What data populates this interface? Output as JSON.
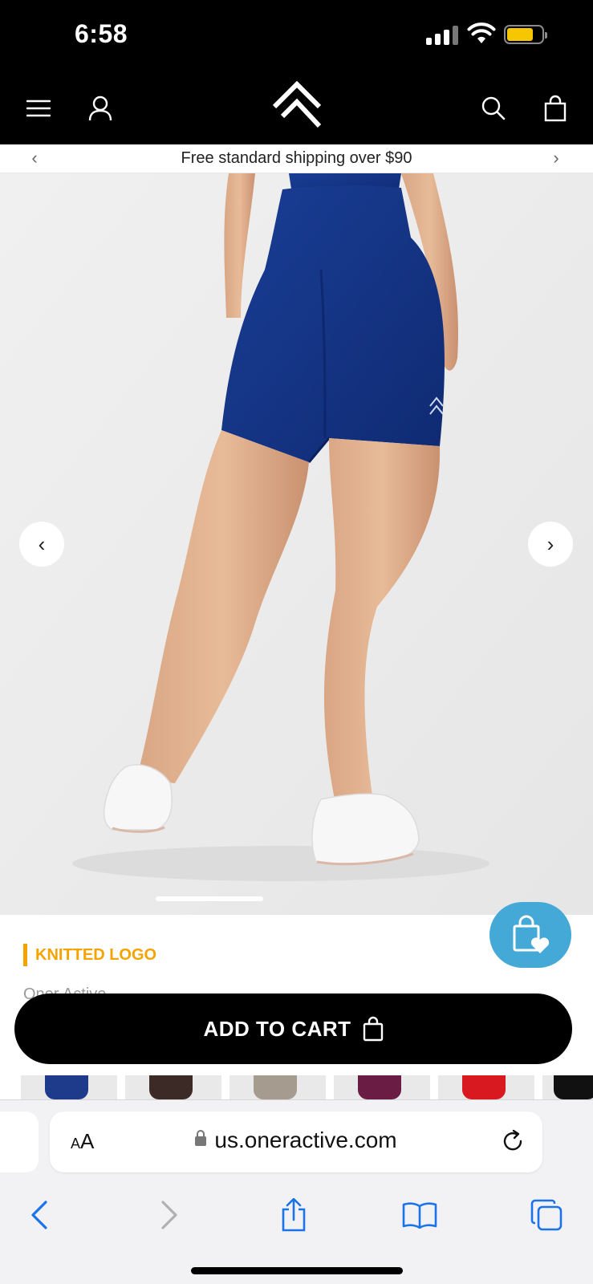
{
  "status_bar": {
    "time": "6:58"
  },
  "announcement": {
    "text": "Free standard shipping over $90"
  },
  "carousel": {
    "position": 0.32
  },
  "product": {
    "tagline": "KNITTED LOGO",
    "brand": "Oner Active",
    "add_to_cart_label": "ADD TO CART"
  },
  "swatch_colors": [
    "#1e3a8a",
    "#3b2a25",
    "#a59b8e",
    "#6b1c44",
    "#d81920",
    "#111111"
  ],
  "browser": {
    "aa_label": "AA",
    "url": "us.oneractive.com"
  },
  "colors": {
    "accent": "#f5a300",
    "wishlist_bg": "#44a9d6",
    "shorts": "#13348a",
    "ios_blue": "#1a73e8"
  }
}
